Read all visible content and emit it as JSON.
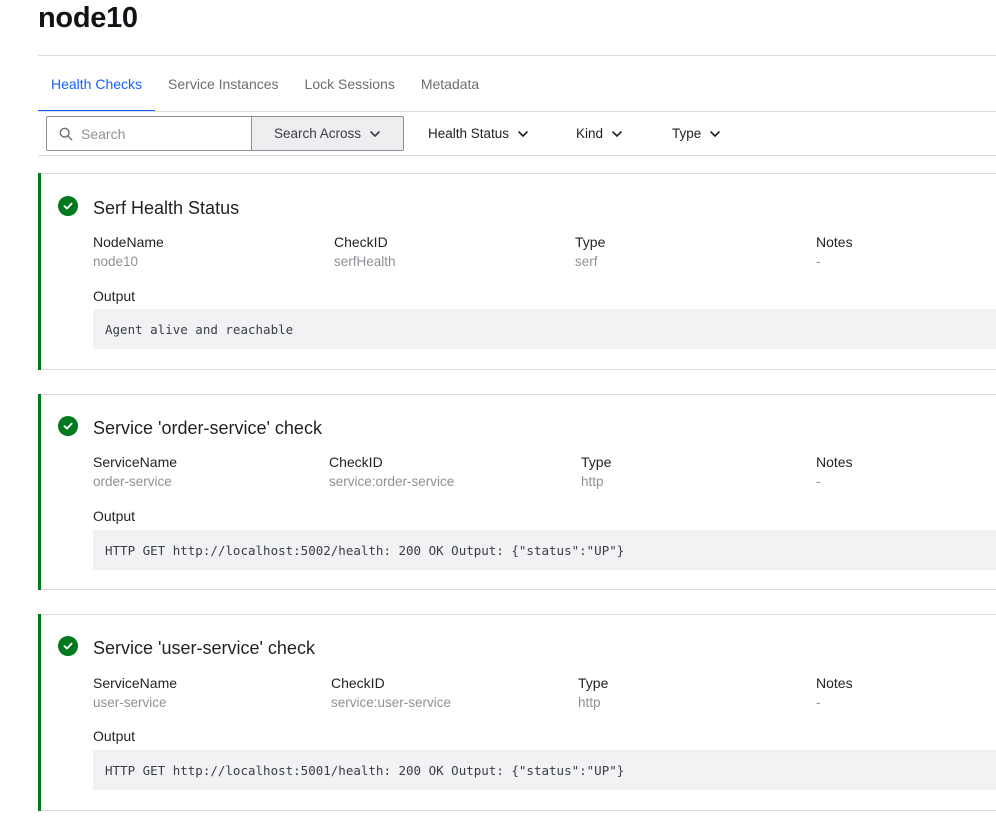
{
  "page": {
    "title": "node10"
  },
  "tabs": [
    {
      "label": "Health Checks",
      "active": true
    },
    {
      "label": "Service Instances",
      "active": false
    },
    {
      "label": "Lock Sessions",
      "active": false
    },
    {
      "label": "Metadata",
      "active": false
    }
  ],
  "toolbar": {
    "search_placeholder": "Search",
    "search_across_label": "Search Across",
    "filters": [
      "Health Status",
      "Kind",
      "Type"
    ]
  },
  "colors": {
    "accent": "#1563ff",
    "passing": "#00781e"
  },
  "checks": [
    {
      "status": "passing",
      "title": "Serf Health Status",
      "fields": [
        {
          "label": "NodeName",
          "value": "node10"
        },
        {
          "label": "CheckID",
          "value": "serfHealth"
        },
        {
          "label": "Type",
          "value": "serf"
        },
        {
          "label": "Notes",
          "value": "-"
        }
      ],
      "output_label": "Output",
      "output": "Agent alive and reachable"
    },
    {
      "status": "passing",
      "title": "Service 'order-service' check",
      "fields": [
        {
          "label": "ServiceName",
          "value": "order-service"
        },
        {
          "label": "CheckID",
          "value": "service:order-service"
        },
        {
          "label": "Type",
          "value": "http"
        },
        {
          "label": "Notes",
          "value": "-"
        }
      ],
      "output_label": "Output",
      "output": "HTTP GET http://localhost:5002/health: 200 OK Output: {\"status\":\"UP\"}"
    },
    {
      "status": "passing",
      "title": "Service 'user-service' check",
      "fields": [
        {
          "label": "ServiceName",
          "value": "user-service"
        },
        {
          "label": "CheckID",
          "value": "service:user-service"
        },
        {
          "label": "Type",
          "value": "http"
        },
        {
          "label": "Notes",
          "value": "-"
        }
      ],
      "output_label": "Output",
      "output": "HTTP GET http://localhost:5001/health: 200 OK Output: {\"status\":\"UP\"}"
    }
  ]
}
